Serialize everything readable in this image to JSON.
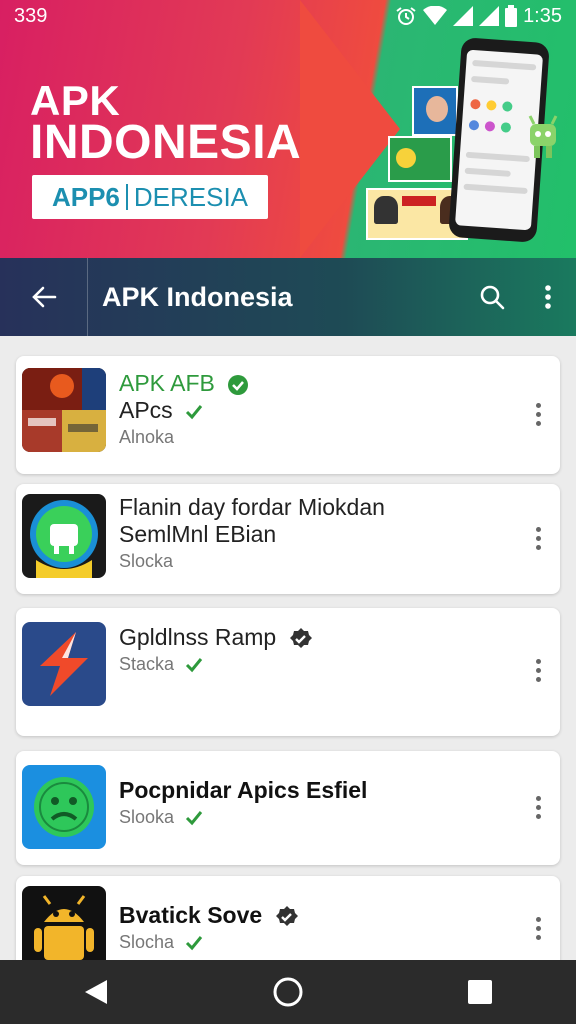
{
  "status_bar": {
    "left_text": "339",
    "time": "1:35",
    "icons": [
      "alarm-icon",
      "wifi-icon",
      "signal-icon",
      "signal-icon",
      "battery-icon"
    ]
  },
  "banner": {
    "title_line1": "APK",
    "title_line2": "INDONESIA",
    "sub_part1": "APP6",
    "sub_part2": "DERESIA"
  },
  "appbar": {
    "title": "APK Indonesia",
    "back_icon": "arrow-left-icon",
    "search_icon": "search-icon",
    "menu_icon": "more-vert-icon"
  },
  "apps": [
    {
      "line1": "APK AFB",
      "line2": "APcs",
      "sub": "Alnoka",
      "icon": "collage-app-icon"
    },
    {
      "line1": "Flanin day fordar Miokdan",
      "line2": "SemlMnl EBian",
      "sub": "Slocka",
      "icon": "android-app-icon"
    },
    {
      "line1": "Gpldlnss Ramp",
      "sub": "Stacka",
      "icon": "bolt-app-icon"
    },
    {
      "line1": "Pocpnidar Apics Esfiel",
      "sub": "Slooka",
      "icon": "android-face-app-icon"
    },
    {
      "line1": "Bvatick Sove",
      "sub": "Slocha",
      "icon": "android-robot-app-icon"
    }
  ],
  "colors": {
    "accent_green": "#2e9a3c",
    "appbar_start": "#27315a",
    "appbar_end": "#1a7a5e"
  },
  "navbar": {
    "icons": [
      "back-triangle-icon",
      "home-circle-icon",
      "recents-square-icon"
    ]
  }
}
